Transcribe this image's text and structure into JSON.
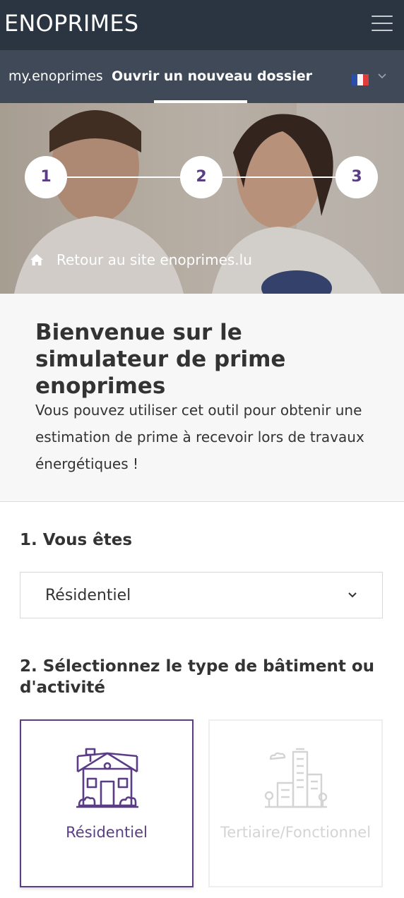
{
  "header": {
    "brand": "ENOPRIMES",
    "menu_icon": "hamburger-icon"
  },
  "nav": {
    "items": [
      {
        "label": "my.enoprimes",
        "active": false
      },
      {
        "label": "Ouvrir un nouveau dossier",
        "active": true
      }
    ],
    "language_icon": "french-flag-icon"
  },
  "hero": {
    "steps": [
      "1",
      "2",
      "3"
    ],
    "back_link": "Retour au site enoprimes.lu",
    "back_icon": "home-icon"
  },
  "intro": {
    "title": "Bienvenue sur le simulateur de prime enoprimes",
    "text": "Vous pouvez utiliser cet outil pour obtenir une estimation de prime à recevoir lors de travaux énergétiques !"
  },
  "question1": {
    "label": "1. Vous êtes",
    "selected_value": "Résidentiel"
  },
  "question2": {
    "label": "2. Sélectionnez le type de bâtiment ou d'activité",
    "options": [
      {
        "label": "Résidentiel",
        "icon": "house-icon",
        "selected": true
      },
      {
        "label": "Tertiaire/Fonctionnel",
        "icon": "office-building-icon",
        "selected": false
      }
    ]
  },
  "colors": {
    "topbar": "#2b3542",
    "navbar": "#3f4957",
    "accent": "#5b3d86",
    "intro_bg": "#f7f7f7"
  }
}
